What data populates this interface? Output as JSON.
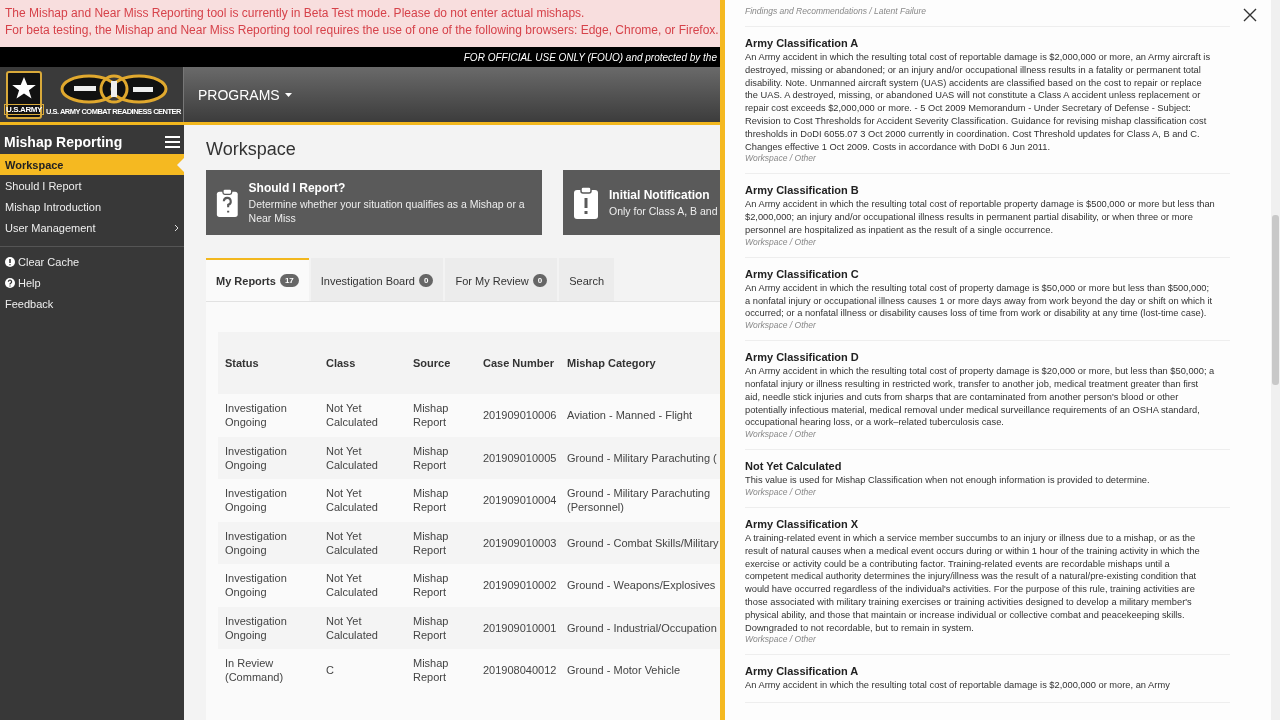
{
  "banner": {
    "lines": [
      "The Mishap and Near Miss Reporting tool is currently in Beta Test mode. Please do not enter actual mishaps.",
      "For beta testing, the Mishap and Near Miss Reporting tool requires the use of one of the following browsers: Edge, Chrome, or Firefox."
    ]
  },
  "notice": "FOR OFFICIAL USE ONLY (FOUO) and protected by the",
  "header": {
    "logo_text": "U.S.ARMY",
    "center_text": "U.S. ARMY COMBAT READINESS CENTER",
    "menu": "PROGRAMS"
  },
  "sidebar": {
    "title": "Mishap Reporting",
    "items": [
      {
        "label": "Workspace",
        "selected": true,
        "kind": "link"
      },
      {
        "label": "Should I Report",
        "selected": false,
        "kind": "link"
      },
      {
        "label": "Mishap Introduction",
        "selected": false,
        "kind": "link"
      },
      {
        "label": "User Management",
        "selected": false,
        "kind": "submenu"
      }
    ],
    "links": [
      {
        "label": "Clear Cache",
        "kind": "alert"
      },
      {
        "label": "Help",
        "kind": "help"
      },
      {
        "label": "Feedback",
        "kind": "plain"
      }
    ]
  },
  "page_title": "Workspace",
  "cards": [
    {
      "title": "Should I Report?",
      "text": "Determine whether your situation qualifies as a Mishap or a Near Miss",
      "kind": "question"
    },
    {
      "title": "Initial Notification",
      "text": "Only for Class A, B and",
      "kind": "alert"
    }
  ],
  "tabs": [
    {
      "label": "My Reports",
      "count": "17",
      "selected": true
    },
    {
      "label": "Investigation Board",
      "count": "0",
      "selected": false
    },
    {
      "label": "For My Review",
      "count": "0",
      "selected": false
    },
    {
      "label": "Search",
      "selected": false
    }
  ],
  "table": {
    "columns": [
      "Status",
      "Class",
      "Source",
      "Case Number",
      "Mishap Category"
    ],
    "rows": [
      [
        "Investigation Ongoing",
        "Not Yet Calculated",
        "Mishap Report",
        "201909010006",
        "Aviation - Manned - Flight"
      ],
      [
        "Investigation Ongoing",
        "Not Yet Calculated",
        "Mishap Report",
        "201909010005",
        "Ground - Military Parachuting ("
      ],
      [
        "Investigation Ongoing",
        "Not Yet Calculated",
        "Mishap Report",
        "201909010004",
        "Ground - Military Parachuting (Personnel)"
      ],
      [
        "Investigation Ongoing",
        "Not Yet Calculated",
        "Mishap Report",
        "201909010003",
        "Ground - Combat Skills/Military"
      ],
      [
        "Investigation Ongoing",
        "Not Yet Calculated",
        "Mishap Report",
        "201909010002",
        "Ground - Weapons/Explosives"
      ],
      [
        "Investigation Ongoing",
        "Not Yet Calculated",
        "Mishap Report",
        "201909010001",
        "Ground - Industrial/Occupation"
      ],
      [
        "In Review (Command)",
        "C",
        "Mishap Report",
        "201908040012",
        "Ground - Motor Vehicle"
      ]
    ]
  },
  "glossary": {
    "lead_path": "Findings and Recommendations / Latent Failure",
    "entries": [
      {
        "term": "Army Classification A",
        "definition": "An Army accident in which the resulting total cost of reportable damage is $2,000,000 or more, an Army aircraft is destroyed, missing or abandoned; or an injury and/or occupational illness results in a fatality or permanent total disability.  Note. Unmanned aircraft system (UAS) accidents are classified based on the cost to repair or replace the UAS.  A destroyed, missing, or abandoned UAS will not constitute a Class A accident unless replacement or repair cost exceeds $2,000,000 or more. - 5 Oct 2009 Memorandum - Under Secretary of Defense - Subject: Revision to Cost Thresholds for Accident Severity Classification. Guidance for revising mishap classification cost thresholds in DoDI 6055.07 3 Oct 2000 currently in coordination. Cost Threshold updates for Class A, B and C. Changes effective 1 Oct 2009. Costs in accordance with DoDI 6 Jun 2011.",
        "path": "Workspace / Other"
      },
      {
        "term": "Army Classification B",
        "definition": "An Army accident in which the resulting total cost of reportable property damage is $500,000 or more but less than $2,000,000; an injury and/or occupational illness results in permanent partial disability, or when three or more personnel are hospitalized as inpatient as the result of a single occurrence.",
        "path": "Workspace / Other"
      },
      {
        "term": "Army Classification C",
        "definition": "An Army accident in which the resulting total cost of property damage is $50,000 or more but less than $500,000; a nonfatal injury or occupational illness causes 1 or more days away from work beyond the day or shift on which it occurred; or a nonfatal illness or disability causes loss of time from work or disability at any time (lost-time case).",
        "path": "Workspace / Other"
      },
      {
        "term": "Army Classification D",
        "definition": "An Army accident in which the resulting total cost of property damage is $20,000 or more, but less than $50,000; a nonfatal injury or illness resulting in restricted work, transfer to another job, medical treatment greater than first aid, needle stick injuries and cuts from sharps that are contaminated from another person's blood or other potentially infectious material, medical removal under medical surveillance requirements of an OSHA standard, occupational hearing loss, or a work–related tuberculosis case.",
        "path": "Workspace / Other"
      },
      {
        "term": "Not Yet Calculated",
        "definition": "This value is used for Mishap Classification when not enough information is provided to determine.",
        "path": "Workspace / Other"
      },
      {
        "term": "Army Classification X",
        "definition": "A training-related event in which a service member succumbs to an injury or illness due to a mishap, or as the result of natural causes when a medical event occurs during or within 1 hour of the training activity in which the exercise or activity could be a contributing factor. Training-related events are recordable mishaps until a competent medical authority determines the injury/illness was the result of a natural/pre-existing condition that would have occurred regardless of the individual's activities. For the purpose of this rule, training activities are those associated with military training exercises or training activities designed to develop a military member's physical ability, and those that maintain or increase individual or collective combat and peacekeeping skills. Downgraded to not recordable, but to remain in system.",
        "path": "Workspace / Other"
      },
      {
        "term": "Army Classification A",
        "definition": "An Army accident in which the resulting total cost of reportable damage is $2,000,000 or more, an Army"
      }
    ]
  }
}
